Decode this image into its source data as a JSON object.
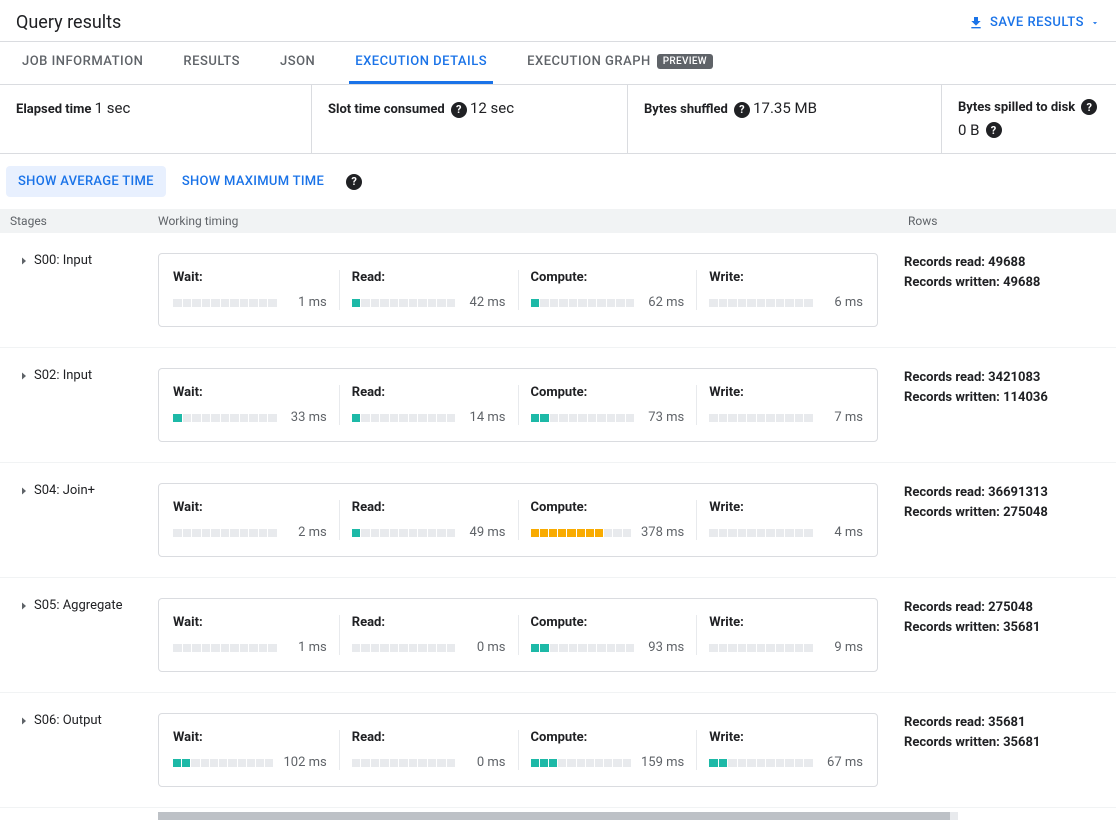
{
  "header": {
    "title": "Query results",
    "save_label": "SAVE RESULTS"
  },
  "tabs": [
    {
      "label": "JOB INFORMATION",
      "active": false
    },
    {
      "label": "RESULTS",
      "active": false
    },
    {
      "label": "JSON",
      "active": false
    },
    {
      "label": "EXECUTION DETAILS",
      "active": true
    },
    {
      "label": "EXECUTION GRAPH",
      "active": false,
      "preview": "PREVIEW"
    }
  ],
  "summary": {
    "elapsed": {
      "label": "Elapsed time",
      "value": "1 sec"
    },
    "slot": {
      "label": "Slot time consumed",
      "value": "12 sec",
      "help": true
    },
    "shuffled": {
      "label": "Bytes shuffled",
      "value": "17.35 MB",
      "help": true
    },
    "spilled": {
      "label": "Bytes spilled to disk",
      "value": "0 B",
      "help": true,
      "value_help": true
    }
  },
  "timeToggle": {
    "avg": "SHOW AVERAGE TIME",
    "max": "SHOW MAXIMUM TIME"
  },
  "columns": {
    "stages": "Stages",
    "timing": "Working timing",
    "rows": "Rows"
  },
  "timingLabels": {
    "wait": "Wait:",
    "read": "Read:",
    "compute": "Compute:",
    "write": "Write:"
  },
  "stages": [
    {
      "name": "S00: Input",
      "wait": {
        "ms": "1 ms",
        "fill": 0,
        "color": "teal"
      },
      "read": {
        "ms": "42 ms",
        "fill": 1,
        "color": "teal"
      },
      "compute": {
        "ms": "62 ms",
        "fill": 1,
        "color": "teal"
      },
      "write": {
        "ms": "6 ms",
        "fill": 0,
        "color": "teal"
      },
      "rows": {
        "read": "Records read: 49688",
        "written": "Records written: 49688"
      }
    },
    {
      "name": "S02: Input",
      "wait": {
        "ms": "33 ms",
        "fill": 1,
        "color": "teal"
      },
      "read": {
        "ms": "14 ms",
        "fill": 1,
        "color": "teal"
      },
      "compute": {
        "ms": "73 ms",
        "fill": 2,
        "color": "teal"
      },
      "write": {
        "ms": "7 ms",
        "fill": 0,
        "color": "teal"
      },
      "rows": {
        "read": "Records read: 3421083",
        "written": "Records written: 114036"
      }
    },
    {
      "name": "S04: Join+",
      "wait": {
        "ms": "2 ms",
        "fill": 0,
        "color": "teal"
      },
      "read": {
        "ms": "49 ms",
        "fill": 1,
        "color": "teal"
      },
      "compute": {
        "ms": "378 ms",
        "fill": 8,
        "color": "amber"
      },
      "write": {
        "ms": "4 ms",
        "fill": 0,
        "color": "teal"
      },
      "rows": {
        "read": "Records read: 36691313",
        "written": "Records written: 275048"
      }
    },
    {
      "name": "S05: Aggregate",
      "wait": {
        "ms": "1 ms",
        "fill": 0,
        "color": "teal"
      },
      "read": {
        "ms": "0 ms",
        "fill": 0,
        "color": "teal"
      },
      "compute": {
        "ms": "93 ms",
        "fill": 2,
        "color": "teal"
      },
      "write": {
        "ms": "9 ms",
        "fill": 0,
        "color": "teal"
      },
      "rows": {
        "read": "Records read: 275048",
        "written": "Records written: 35681"
      }
    },
    {
      "name": "S06: Output",
      "wait": {
        "ms": "102 ms",
        "fill": 2,
        "color": "teal"
      },
      "read": {
        "ms": "0 ms",
        "fill": 0,
        "color": "teal"
      },
      "compute": {
        "ms": "159 ms",
        "fill": 3,
        "color": "teal"
      },
      "write": {
        "ms": "67 ms",
        "fill": 2,
        "color": "teal"
      },
      "rows": {
        "read": "Records read: 35681",
        "written": "Records written: 35681"
      }
    }
  ]
}
